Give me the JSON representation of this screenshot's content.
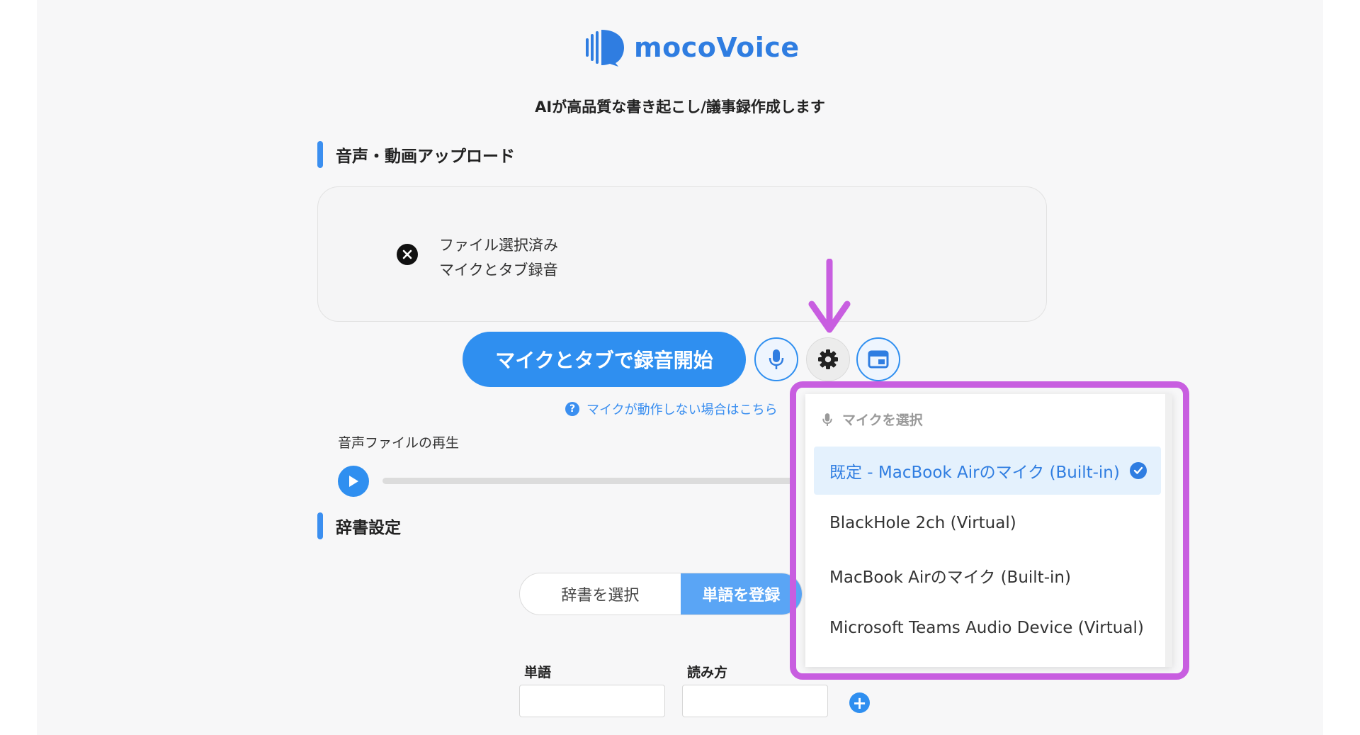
{
  "app": {
    "name": "mocoVoice",
    "tagline": "AIが高品質な書き起こし/議事録作成します"
  },
  "upload_section": {
    "title": "音声・動画アップロード",
    "status_line1": "ファイル選択済み",
    "status_line2": "マイクとタブ録音"
  },
  "controls": {
    "record_label": "マイクとタブで録音開始",
    "help_text": "マイクが動作しない場合はこちら",
    "playback_label": "音声ファイルの再生"
  },
  "dictionary": {
    "title": "辞書設定",
    "tabs": [
      "辞書を選択",
      "単語を登録"
    ],
    "active_tab": 1,
    "word_label": "単語",
    "reading_label": "読み方",
    "add_label": "+"
  },
  "mic_dropdown": {
    "header": "マイクを選択",
    "items": [
      "既定 - MacBook Airのマイク (Built-in)",
      "BlackHole 2ch (Virtual)",
      "MacBook Airのマイク (Built-in)",
      "Microsoft Teams Audio Device (Virtual)"
    ],
    "selected_index": 0
  },
  "colors": {
    "accent": "#2f8ff0",
    "annotation": "#c85ee0",
    "selected_bg": "#e4f1fd"
  },
  "icons": [
    "close-icon",
    "microphone-icon",
    "gear-icon",
    "browser-tab-icon",
    "question-icon",
    "play-icon",
    "check-icon",
    "arrow-down-annotation"
  ]
}
